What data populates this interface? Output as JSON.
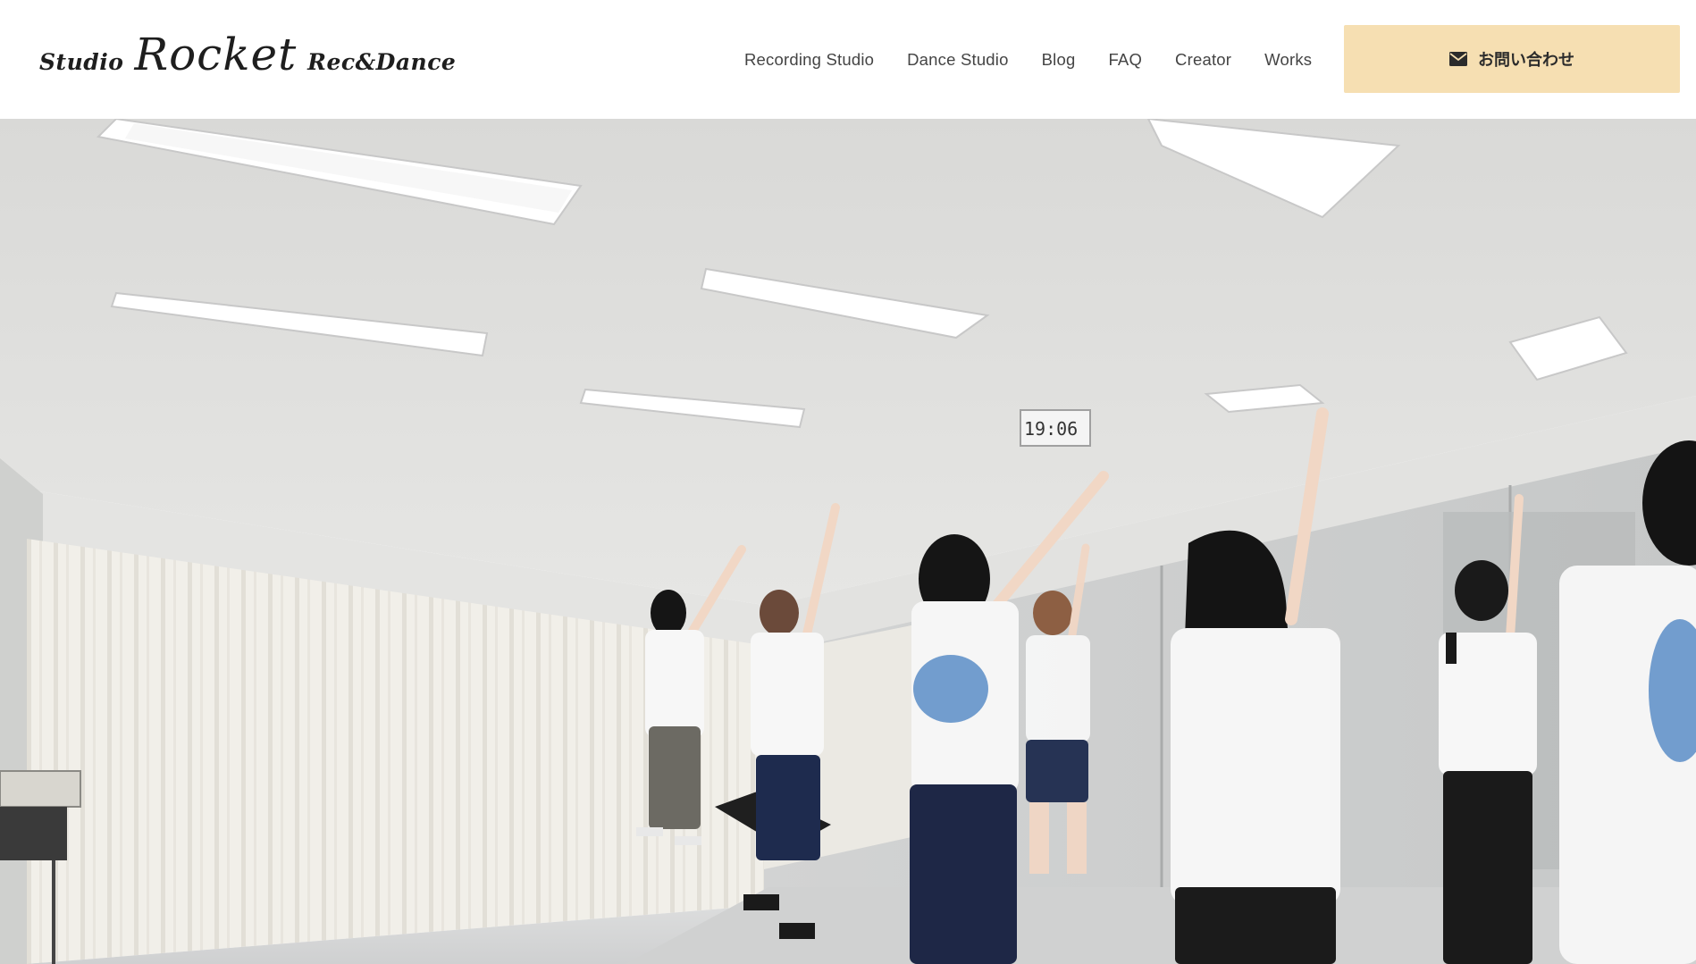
{
  "header": {
    "logo": {
      "prefix": "Studio",
      "main": "Rocket",
      "suffix": "Rec&Dance"
    },
    "nav": [
      {
        "label": "Recording Studio"
      },
      {
        "label": "Dance Studio"
      },
      {
        "label": "Blog"
      },
      {
        "label": "FAQ"
      },
      {
        "label": "Creator"
      },
      {
        "label": "Works"
      }
    ],
    "contact": {
      "icon": "envelope-icon",
      "label": "お問い合わせ"
    }
  },
  "hero": {
    "clock_text": "19:06"
  },
  "colors": {
    "contact_bg": "#f6dfb2",
    "ceiling": "#dcdcda",
    "curtain": "#f1efe9",
    "floor": "#d7d8d8"
  }
}
